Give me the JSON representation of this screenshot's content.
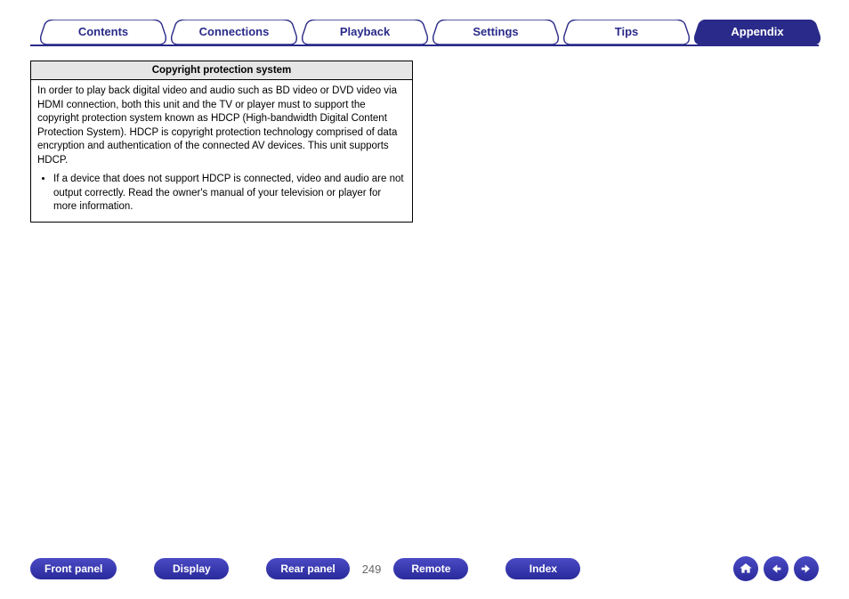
{
  "tabs": [
    {
      "label": "Contents",
      "active": false
    },
    {
      "label": "Connections",
      "active": false
    },
    {
      "label": "Playback",
      "active": false
    },
    {
      "label": "Settings",
      "active": false
    },
    {
      "label": "Tips",
      "active": false
    },
    {
      "label": "Appendix",
      "active": true
    }
  ],
  "infobox": {
    "title": "Copyright protection system",
    "paragraph": "In order to play back digital video and audio such as BD video or DVD video via HDMI connection, both this unit and the TV or player must to support the copyright protection system known as HDCP (High-bandwidth Digital Content Protection System). HDCP is copyright protection technology comprised of data encryption and authentication of the connected AV devices. This unit supports HDCP.",
    "bullet": "If a device that does not support HDCP is connected, video and audio are not output correctly. Read the owner's manual of your television or player for more information."
  },
  "bottom": {
    "front_panel": "Front panel",
    "display": "Display",
    "rear_panel": "Rear panel",
    "page_number": "249",
    "remote": "Remote",
    "index": "Index"
  },
  "colors": {
    "brand": "#2a2a8a"
  }
}
